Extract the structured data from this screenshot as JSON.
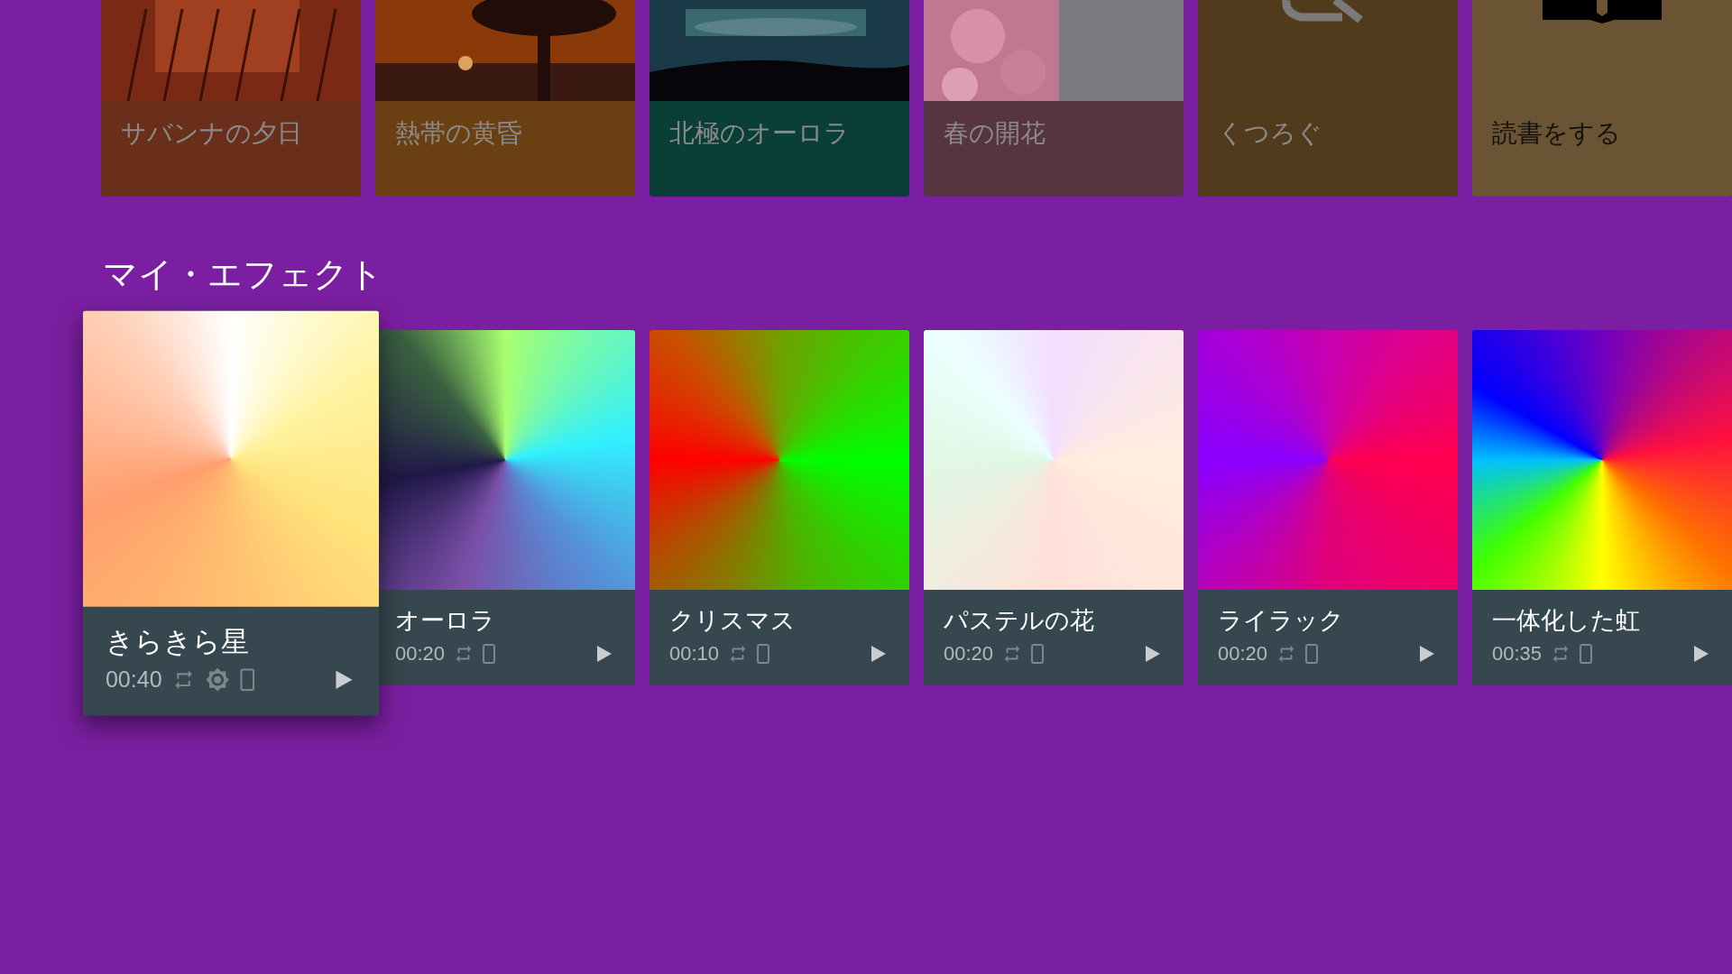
{
  "featured": [
    {
      "title": "サバンナの夕日",
      "kind": "picture",
      "dimmed": true,
      "color": "#6a2f1a"
    },
    {
      "title": "熱帯の黄昏",
      "kind": "picture",
      "dimmed": true,
      "color": "#6a3f12"
    },
    {
      "title": "北極のオーロラ",
      "kind": "picture",
      "dimmed": true,
      "color": "#0a3f38"
    },
    {
      "title": "春の開花",
      "kind": "picture",
      "dimmed": true,
      "color": "#573540"
    },
    {
      "title": "くつろぐ",
      "kind": "icon",
      "dimmed": true,
      "color": "#523b1c"
    },
    {
      "title": "読書をする",
      "kind": "icon",
      "dimmed": false,
      "color": "#6b5433"
    }
  ],
  "section_title": "マイ・エフェクト",
  "effects": [
    {
      "title": "きらきら星",
      "duration": "00:40",
      "brightness": true,
      "selected": true
    },
    {
      "title": "オーロラ",
      "duration": "00:20",
      "brightness": false,
      "selected": false
    },
    {
      "title": "クリスマス",
      "duration": "00:10",
      "brightness": false,
      "selected": false
    },
    {
      "title": "パステルの花",
      "duration": "00:20",
      "brightness": false,
      "selected": false
    },
    {
      "title": "ライラック",
      "duration": "00:20",
      "brightness": false,
      "selected": false
    },
    {
      "title": "一体化した虹",
      "duration": "00:35",
      "brightness": false,
      "selected": false
    }
  ]
}
